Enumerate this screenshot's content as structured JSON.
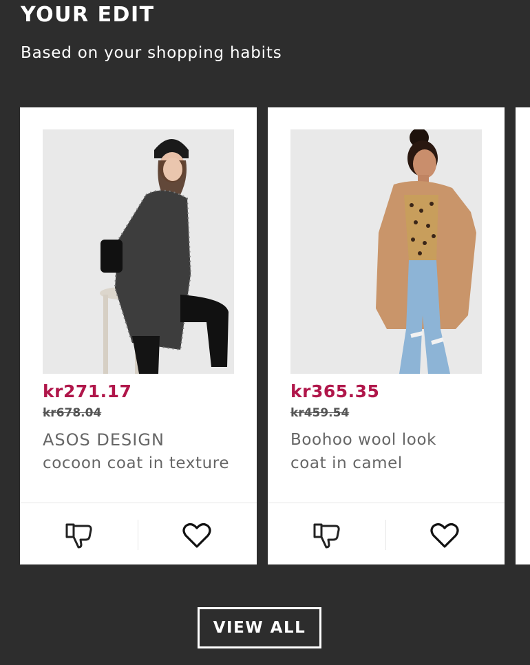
{
  "section": {
    "title": "YOUR EDIT",
    "subtitle": "Based on your shopping habits"
  },
  "products": [
    {
      "price": "kr271.17",
      "old_price": "kr678.04",
      "name_brand": "ASOS DESIGN",
      "name_rest": "cocoon coat in texture",
      "image_icon": "model-in-grey-textured-coat"
    },
    {
      "price": "kr365.35",
      "old_price": "kr459.54",
      "name_line1": "Boohoo wool look",
      "name_line2": "coat in camel",
      "image_icon": "model-in-camel-coat"
    }
  ],
  "actions": {
    "dislike_icon": "thumbs-down-icon",
    "save_icon": "heart-icon"
  },
  "view_all_label": "VIEW ALL",
  "colors": {
    "background": "#2d2d2d",
    "sale_price": "#b0164a",
    "card": "#ffffff"
  }
}
